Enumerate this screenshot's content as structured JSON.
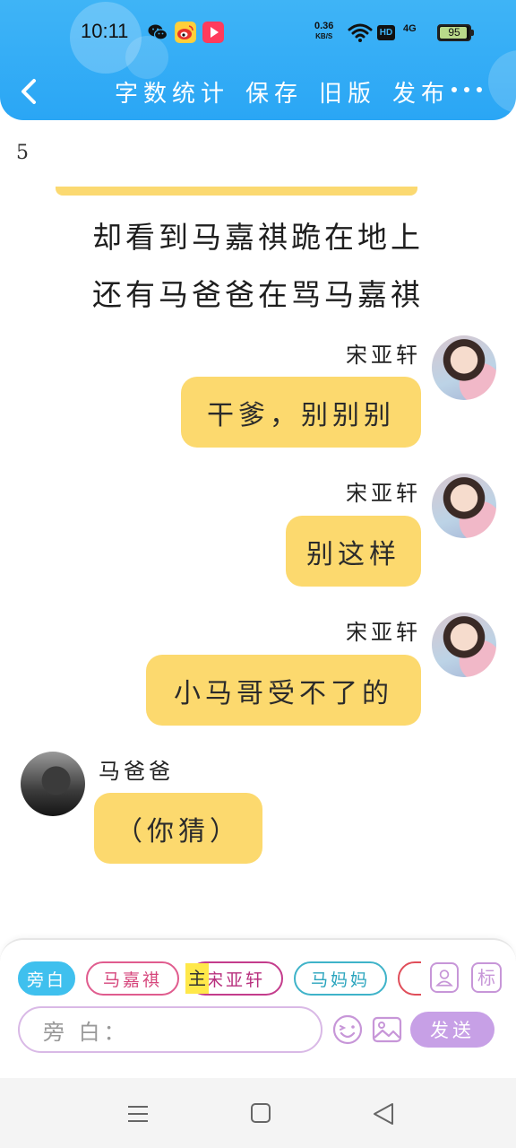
{
  "status_bar": {
    "time": "10:11",
    "net_speed_value": "0.36",
    "net_speed_unit": "KB/S",
    "hd": "HD",
    "signal": "4G",
    "battery": "95",
    "battery_level": 0.95,
    "icons": [
      "wechat-icon",
      "weibo-icon",
      "video-app-icon",
      "wifi-icon",
      "battery-icon"
    ]
  },
  "header": {
    "actions": [
      "字数统计",
      "保存",
      "旧版",
      "发布"
    ],
    "colors": {
      "accent": "#2aa6f5"
    }
  },
  "content": {
    "page_number": "5",
    "narration": [
      "却看到马嘉祺跪在地上",
      "还有马爸爸在骂马嘉祺"
    ],
    "messages": [
      {
        "speaker": "宋亚轩",
        "text": "干爹，别别别",
        "side": "right"
      },
      {
        "speaker": "宋亚轩",
        "text": "别这样",
        "side": "right"
      },
      {
        "speaker": "宋亚轩",
        "text": "小马哥受不了的",
        "side": "right"
      },
      {
        "speaker": "马爸爸",
        "text": "（你猜）",
        "side": "left"
      }
    ],
    "bubble_color": "#fcd96e"
  },
  "input_panel": {
    "roles": [
      "旁白",
      "马嘉祺",
      "宋亚轩",
      "马妈妈",
      ""
    ],
    "main_tag": "主",
    "tag_button": "标",
    "placeholder": "旁 白：",
    "send_label": "发送"
  }
}
